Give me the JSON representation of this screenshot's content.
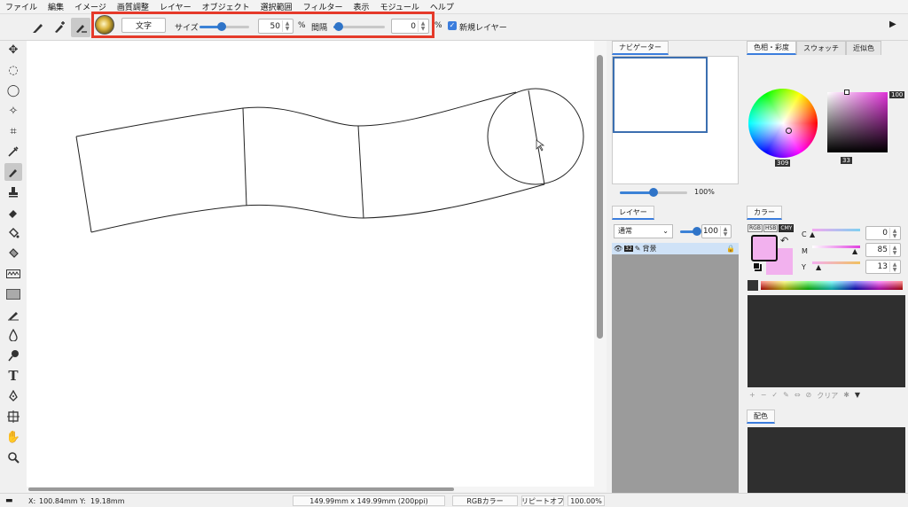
{
  "menu": [
    "ファイル",
    "編集",
    "イメージ",
    "画質調整",
    "レイヤー",
    "オブジェクト",
    "選択範囲",
    "フィルター",
    "表示",
    "モジュール",
    "ヘルプ"
  ],
  "options": {
    "text_button": "文字",
    "size_label": "サイズ",
    "size_value": "50",
    "size_unit": "%",
    "spacing_label": "間隔",
    "spacing_value": "0",
    "spacing_unit": "%",
    "new_layer_label": "新規レイヤー",
    "size_slider_level": 0.45,
    "spacing_slider_level": 0.1
  },
  "navigator": {
    "tab": "ナビゲーター",
    "zoom": "100%"
  },
  "layers": {
    "tab": "レイヤー",
    "blend_mode": "通常",
    "opacity": "100",
    "layer_name": "背景",
    "bit_badge": "32"
  },
  "color_wheel": {
    "tabs": [
      "色相・彩度",
      "スウォッチ",
      "近似色"
    ],
    "hue": "309",
    "brightness": "33",
    "saturation": "100"
  },
  "color": {
    "tab": "カラー",
    "modes": [
      "RGB",
      "HSB",
      "CMY"
    ],
    "channels": [
      {
        "label": "C",
        "value": "0"
      },
      {
        "label": "M",
        "value": "85"
      },
      {
        "label": "Y",
        "value": "13"
      }
    ],
    "foreground": "#f2b1ee",
    "swatch_toolbar": [
      "+",
      "−",
      "✓",
      "✎",
      "⇔",
      "⊘",
      "クリア",
      "✱",
      "▼"
    ]
  },
  "palette": {
    "tab": "配色"
  },
  "status": {
    "x_label": "X:",
    "x_value": "100.84mm",
    "y_label": "Y:",
    "y_value": "19.18mm",
    "doc_size": "149.99mm x 149.99mm (200ppi)",
    "color_mode": "RGBカラー",
    "repeat": "リピートオフ",
    "zoom": "100.00%"
  },
  "accent_color": "#3b7ddd",
  "highlight_color": "#e53a2a"
}
